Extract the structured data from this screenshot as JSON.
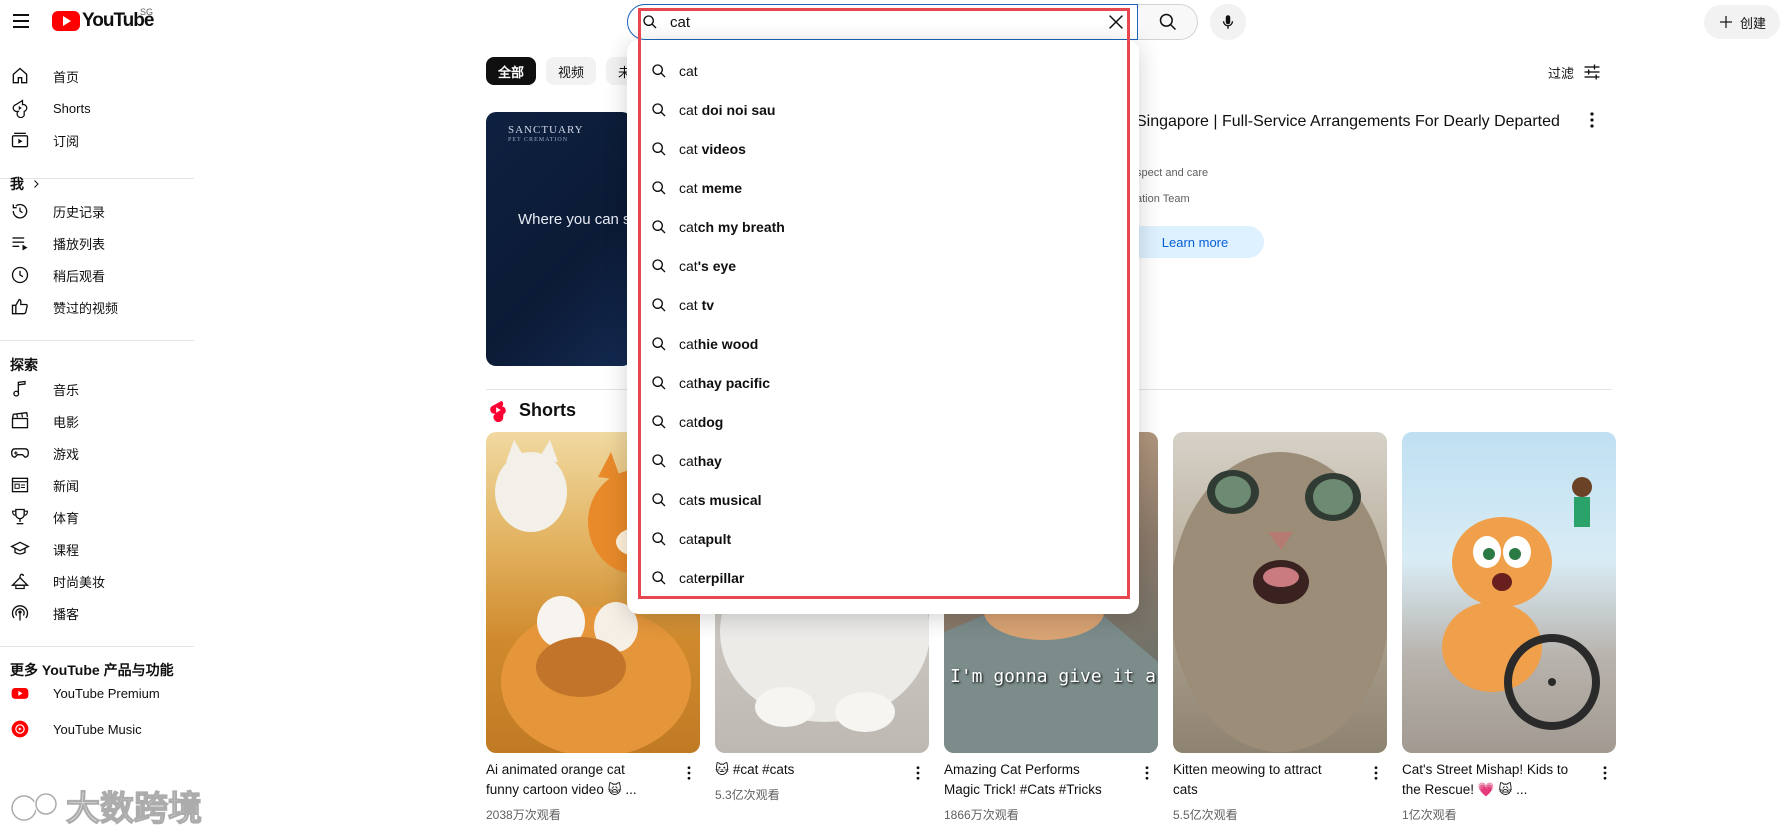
{
  "header": {
    "logo_text": "YouTube",
    "region": "SG",
    "search_value": "cat",
    "create_label": "创建"
  },
  "sidebar": {
    "primary": [
      {
        "label": "首页",
        "icon": "home-icon"
      },
      {
        "label": "Shorts",
        "icon": "shorts-icon"
      },
      {
        "label": "订阅",
        "icon": "subscriptions-icon"
      }
    ],
    "you_heading": "我",
    "you": [
      {
        "label": "历史记录",
        "icon": "history-icon"
      },
      {
        "label": "播放列表",
        "icon": "playlist-icon"
      },
      {
        "label": "稍后观看",
        "icon": "watch-later-icon"
      },
      {
        "label": "赞过的视频",
        "icon": "liked-icon"
      }
    ],
    "explore_heading": "探索",
    "explore": [
      {
        "label": "音乐",
        "icon": "music-icon"
      },
      {
        "label": "电影",
        "icon": "movie-icon"
      },
      {
        "label": "游戏",
        "icon": "gaming-icon"
      },
      {
        "label": "新闻",
        "icon": "news-icon"
      },
      {
        "label": "体育",
        "icon": "trophy-icon"
      },
      {
        "label": "课程",
        "icon": "learning-icon"
      },
      {
        "label": "时尚美妆",
        "icon": "fashion-icon"
      },
      {
        "label": "播客",
        "icon": "podcast-icon"
      }
    ],
    "more_heading": "更多 YouTube 产品与功能",
    "more": [
      {
        "label": "YouTube Premium",
        "icon": "youtube-premium-icon"
      },
      {
        "label": "YouTube Music",
        "icon": "youtube-music-icon"
      }
    ]
  },
  "chips": [
    "全部",
    "视频",
    "未观"
  ],
  "filter_label": "过滤",
  "ad": {
    "brand": "SANCTUARY",
    "brand_sub": "PET CREMATION",
    "tagline": "Where you can se",
    "title": "Singapore | Full-Service Arrangements For Dearly Departed",
    "description": "spect and care",
    "sponsor": "ation Team",
    "cta": "Learn more"
  },
  "shorts": {
    "heading": "Shorts",
    "items": [
      {
        "title_line1": "Ai animated orange cat",
        "title_line2": "funny cartoon video 🙀 ...",
        "views": "2038万次观看"
      },
      {
        "title_line1": "🐱 #cat #cats",
        "title_line2": "",
        "views": "5.3亿次观看"
      },
      {
        "title_line1": "Amazing Cat Performs",
        "title_line2": "Magic Trick! #Cats #Tricks",
        "views": "1866万次观看",
        "caption": "I'm gonna give it a go!"
      },
      {
        "title_line1": "Kitten meowing to attract",
        "title_line2": "cats",
        "views": "5.5亿次观看"
      },
      {
        "title_line1": "Cat's Street Mishap! Kids to",
        "title_line2": "the Rescue! 💗 🙀 ...",
        "views": "1亿次观看"
      }
    ]
  },
  "suggestions": [
    {
      "prefix": "cat",
      "rest": ""
    },
    {
      "prefix": "cat",
      "rest": " doi noi sau"
    },
    {
      "prefix": "cat",
      "rest": " videos"
    },
    {
      "prefix": "cat",
      "rest": " meme"
    },
    {
      "prefix": "cat",
      "rest": "ch my breath"
    },
    {
      "prefix": "cat",
      "rest": "'s eye"
    },
    {
      "prefix": "cat",
      "rest": " tv"
    },
    {
      "prefix": "cat",
      "rest": "hie wood"
    },
    {
      "prefix": "cat",
      "rest": "hay pacific"
    },
    {
      "prefix": "cat",
      "rest": "dog"
    },
    {
      "prefix": "cat",
      "rest": "hay"
    },
    {
      "prefix": "cat",
      "rest": "s musical"
    },
    {
      "prefix": "cat",
      "rest": "apult"
    },
    {
      "prefix": "cat",
      "rest": "erpillar"
    }
  ],
  "watermark_text": "大数跨境",
  "colors": {
    "brand_red": "#ff0000",
    "search_border": "#1c62b9",
    "highlight_red": "#e8474f",
    "learn_more_bg": "#def1ff",
    "learn_more_text": "#065fd4"
  }
}
